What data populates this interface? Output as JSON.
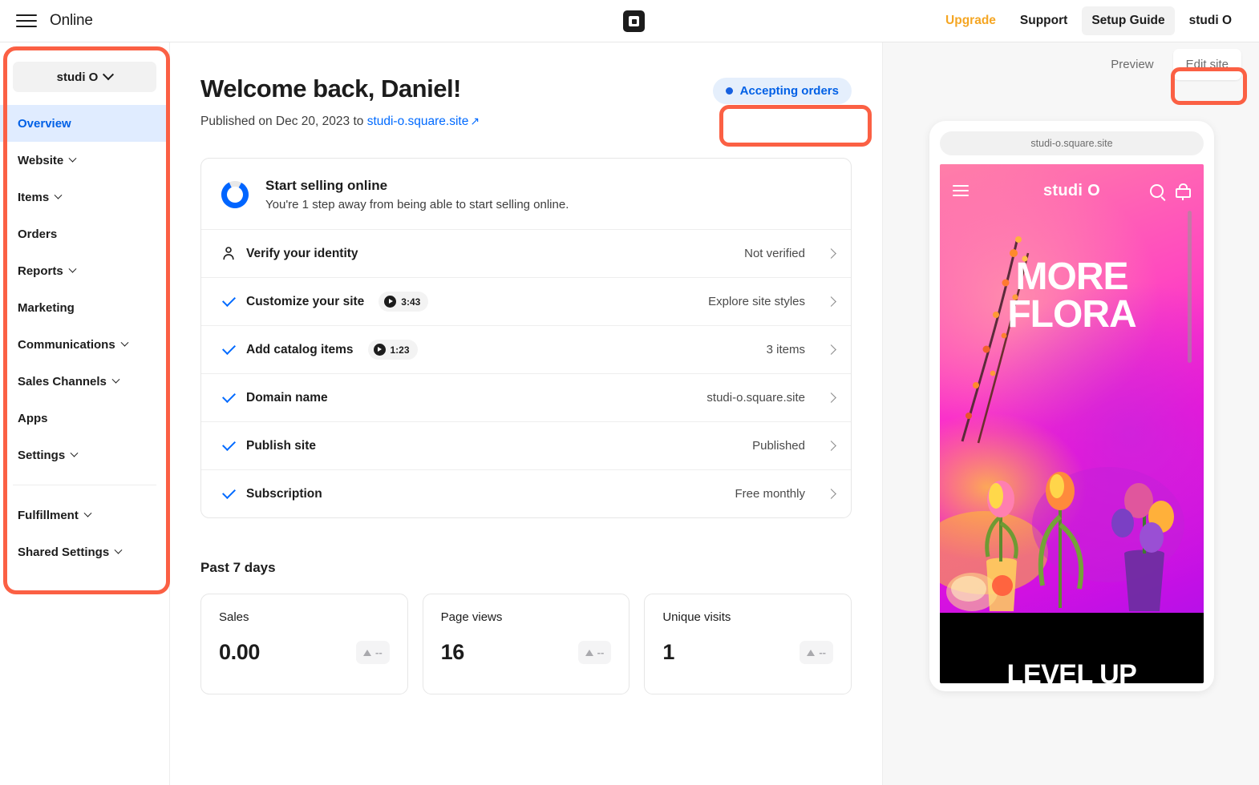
{
  "topbar": {
    "menu_icon": "hamburger-icon",
    "title": "Online",
    "logo": "square-logo",
    "links": [
      {
        "label": "Upgrade",
        "style": "upgrade"
      },
      {
        "label": "Support",
        "style": "plain"
      },
      {
        "label": "Setup Guide",
        "style": "active"
      },
      {
        "label": "studi O",
        "style": "plain"
      }
    ]
  },
  "sidebar": {
    "store_switcher": {
      "label": "studi O",
      "icon": "chevron-down-icon"
    },
    "items": [
      {
        "label": "Overview",
        "expandable": false,
        "active": true
      },
      {
        "label": "Website",
        "expandable": true,
        "active": false
      },
      {
        "label": "Items",
        "expandable": true,
        "active": false
      },
      {
        "label": "Orders",
        "expandable": false,
        "active": false
      },
      {
        "label": "Reports",
        "expandable": true,
        "active": false
      },
      {
        "label": "Marketing",
        "expandable": false,
        "active": false
      },
      {
        "label": "Communications",
        "expandable": true,
        "active": false
      },
      {
        "label": "Sales Channels",
        "expandable": true,
        "active": false
      },
      {
        "label": "Apps",
        "expandable": false,
        "active": false
      },
      {
        "label": "Settings",
        "expandable": true,
        "active": false
      }
    ],
    "items_secondary": [
      {
        "label": "Fulfillment",
        "expandable": true
      },
      {
        "label": "Shared Settings",
        "expandable": true
      }
    ]
  },
  "main": {
    "welcome_title": "Welcome back, Daniel!",
    "published_prefix": "Published on Dec 20, 2023 to ",
    "published_link": "studi-o.square.site",
    "published_link_icon": "external-link-icon",
    "status_pill": {
      "label": "Accepting orders",
      "icon": "status-dot-icon"
    },
    "setup": {
      "progress_percent": 85,
      "title": "Start selling online",
      "subtitle": "You're 1 step away from being able to start selling online.",
      "rows": [
        {
          "label": "Verify your identity",
          "icon": "person-icon",
          "done": false,
          "video": null,
          "value": "Not verified"
        },
        {
          "label": "Customize your site",
          "icon": "check-icon",
          "done": true,
          "video": "3:43",
          "value": "Explore site styles"
        },
        {
          "label": "Add catalog items",
          "icon": "check-icon",
          "done": true,
          "video": "1:23",
          "value": "3 items"
        },
        {
          "label": "Domain name",
          "icon": "check-icon",
          "done": true,
          "video": null,
          "value": "studi-o.square.site"
        },
        {
          "label": "Publish site",
          "icon": "check-icon",
          "done": true,
          "video": null,
          "value": "Published"
        },
        {
          "label": "Subscription",
          "icon": "check-icon",
          "done": true,
          "video": null,
          "value": "Free monthly"
        }
      ]
    },
    "stats_section_title": "Past 7 days",
    "stats": [
      {
        "label": "Sales",
        "value": "0.00",
        "delta": "--"
      },
      {
        "label": "Page views",
        "value": "16",
        "delta": "--"
      },
      {
        "label": "Unique visits",
        "value": "1",
        "delta": "--"
      }
    ]
  },
  "preview_panel": {
    "preview_button": "Preview",
    "edit_button": "Edit site",
    "phone": {
      "url": "studi-o.square.site",
      "brand": "studi O",
      "menu_icon": "hamburger-icon",
      "search_icon": "search-icon",
      "cart_icon": "cart-icon",
      "hero_line1": "MORE",
      "hero_line2": "FLORA",
      "band_text": "LEVEL UP"
    }
  },
  "highlights": {
    "color": "#fb6044",
    "targets": [
      "sidebar",
      "accepting-orders-pill",
      "edit-site-button"
    ]
  }
}
